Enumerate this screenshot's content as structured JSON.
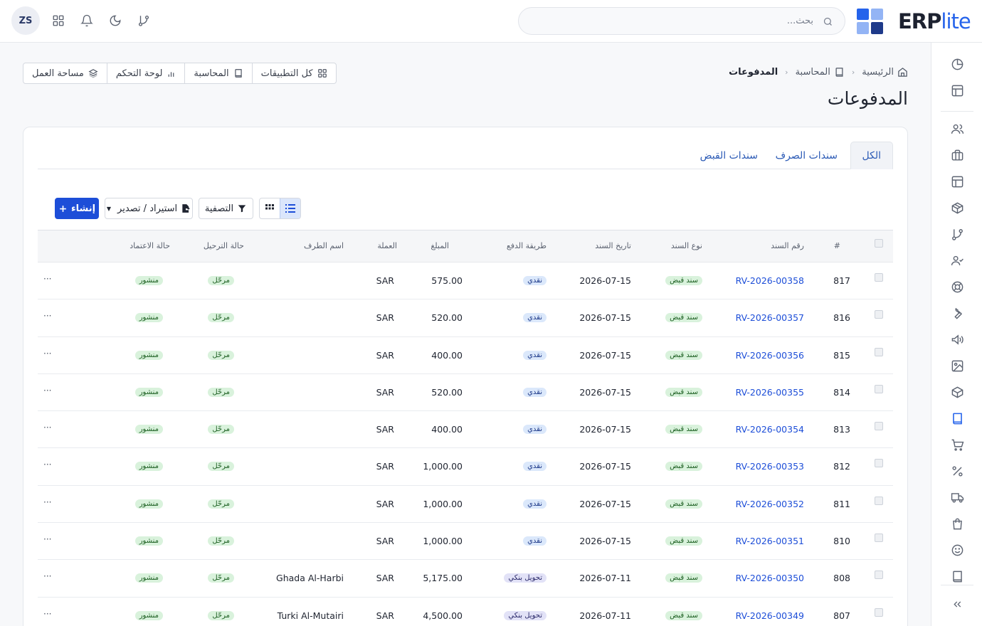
{
  "header": {
    "avatar_initials": "ZS",
    "search_placeholder": "بحث...",
    "logo_erp": "ERP",
    "logo_lite": "lite",
    "brand_color": "#2563eb"
  },
  "quicknav": [
    {
      "label": "كل التطبيقات",
      "icon": "grid-icon"
    },
    {
      "label": "المحاسبة",
      "icon": "book-icon"
    },
    {
      "label": "لوحة التحكم",
      "icon": "bar-chart-icon"
    },
    {
      "label": "مساحة العمل",
      "icon": "layers-icon"
    }
  ],
  "breadcrumb": {
    "home": "الرئيسية",
    "section": "المحاسبة",
    "current": "المدفوعات"
  },
  "page_title": "المدفوعات",
  "tabs": [
    {
      "label": "الكل",
      "active": true
    },
    {
      "label": "سندات الصرف",
      "active": false
    },
    {
      "label": "سندات القبض",
      "active": false
    }
  ],
  "toolbar": {
    "create_label": "إنشاء",
    "import_export_label": "استيراد / تصدير",
    "filter_label": "التصفية"
  },
  "table": {
    "columns": {
      "index": "#",
      "voucher_no": "رقم السند",
      "voucher_type": "نوع السند",
      "voucher_date": "تاريخ السند",
      "payment_method": "طريقة الدفع",
      "amount": "المبلغ",
      "currency": "العملة",
      "party_name": "اسم الطرف",
      "posting_status": "حالة الترحيل",
      "approval_status": "حالة الاعتماد"
    },
    "rows": [
      {
        "index": "817",
        "voucher_no": "RV-2026-00358",
        "voucher_type": "سند قبض",
        "date": "2026-07-15",
        "method": "نقدي",
        "method_kind": "cash",
        "amount": "575.00",
        "currency": "SAR",
        "party": "",
        "posting": "مرحّل",
        "approval": "منشور"
      },
      {
        "index": "816",
        "voucher_no": "RV-2026-00357",
        "voucher_type": "سند قبض",
        "date": "2026-07-15",
        "method": "نقدي",
        "method_kind": "cash",
        "amount": "520.00",
        "currency": "SAR",
        "party": "",
        "posting": "مرحّل",
        "approval": "منشور"
      },
      {
        "index": "815",
        "voucher_no": "RV-2026-00356",
        "voucher_type": "سند قبض",
        "date": "2026-07-15",
        "method": "نقدي",
        "method_kind": "cash",
        "amount": "400.00",
        "currency": "SAR",
        "party": "",
        "posting": "مرحّل",
        "approval": "منشور"
      },
      {
        "index": "814",
        "voucher_no": "RV-2026-00355",
        "voucher_type": "سند قبض",
        "date": "2026-07-15",
        "method": "نقدي",
        "method_kind": "cash",
        "amount": "520.00",
        "currency": "SAR",
        "party": "",
        "posting": "مرحّل",
        "approval": "منشور"
      },
      {
        "index": "813",
        "voucher_no": "RV-2026-00354",
        "voucher_type": "سند قبض",
        "date": "2026-07-15",
        "method": "نقدي",
        "method_kind": "cash",
        "amount": "400.00",
        "currency": "SAR",
        "party": "",
        "posting": "مرحّل",
        "approval": "منشور"
      },
      {
        "index": "812",
        "voucher_no": "RV-2026-00353",
        "voucher_type": "سند قبض",
        "date": "2026-07-15",
        "method": "نقدي",
        "method_kind": "cash",
        "amount": "1,000.00",
        "currency": "SAR",
        "party": "",
        "posting": "مرحّل",
        "approval": "منشور"
      },
      {
        "index": "811",
        "voucher_no": "RV-2026-00352",
        "voucher_type": "سند قبض",
        "date": "2026-07-15",
        "method": "نقدي",
        "method_kind": "cash",
        "amount": "1,000.00",
        "currency": "SAR",
        "party": "",
        "posting": "مرحّل",
        "approval": "منشور"
      },
      {
        "index": "810",
        "voucher_no": "RV-2026-00351",
        "voucher_type": "سند قبض",
        "date": "2026-07-15",
        "method": "نقدي",
        "method_kind": "cash",
        "amount": "1,000.00",
        "currency": "SAR",
        "party": "",
        "posting": "مرحّل",
        "approval": "منشور"
      },
      {
        "index": "808",
        "voucher_no": "RV-2026-00350",
        "voucher_type": "سند قبض",
        "date": "2026-07-11",
        "method": "تحويل بنكي",
        "method_kind": "bank",
        "amount": "5,175.00",
        "currency": "SAR",
        "party": "Ghada Al-Harbi",
        "posting": "مرحّل",
        "approval": "منشور"
      },
      {
        "index": "807",
        "voucher_no": "RV-2026-00349",
        "voucher_type": "سند قبض",
        "date": "2026-07-11",
        "method": "تحويل بنكي",
        "method_kind": "bank",
        "amount": "4,500.00",
        "currency": "SAR",
        "party": "Turki Al-Mutairi",
        "posting": "مرحّل",
        "approval": "منشور"
      }
    ],
    "row_actions_label": "···"
  },
  "sidebar_icons": [
    "pie-chart-icon",
    "layout-icon",
    "users-icon",
    "briefcase-icon",
    "layout-icon",
    "box-icon",
    "git-branch-icon",
    "user-check-icon",
    "lifebuoy-icon",
    "wrench-icon",
    "megaphone-icon",
    "image-icon",
    "package-icon",
    "book-icon",
    "cart-icon",
    "percent-icon",
    "truck-icon",
    "shopping-bag-icon",
    "smile-icon",
    "book-icon",
    "collapse-icon"
  ]
}
